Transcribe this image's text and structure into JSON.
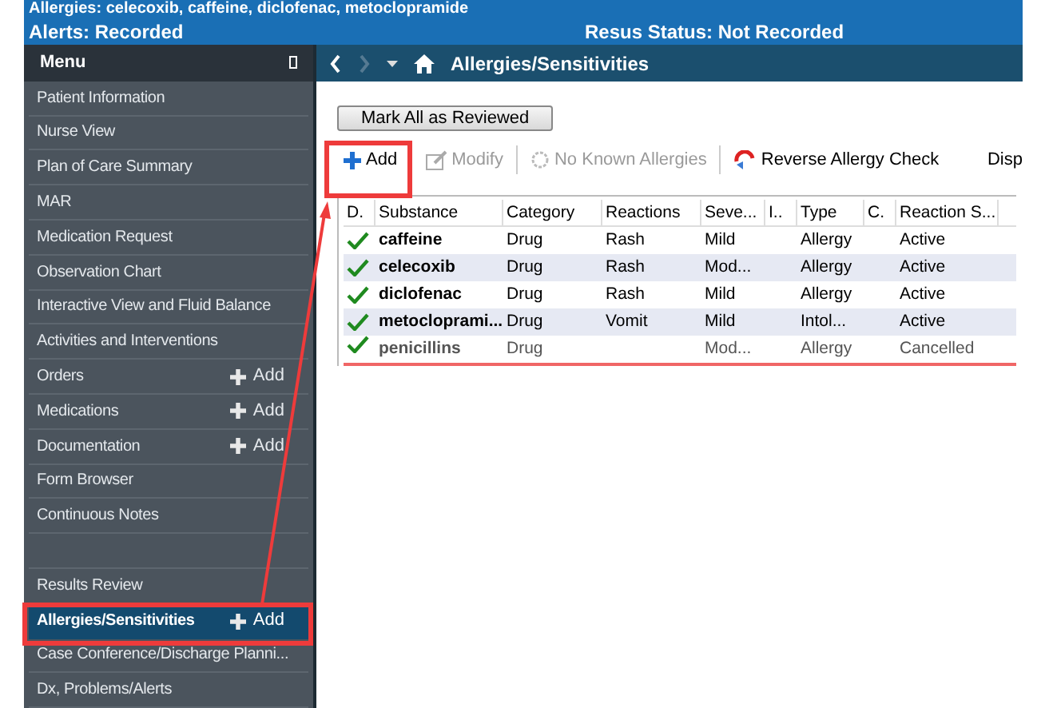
{
  "banner": {
    "allergies_line": "Allergies: celecoxib, caffeine, diclofenac, metoclopramide",
    "alerts": "Alerts: Recorded",
    "resus": "Resus Status: Not Recorded"
  },
  "menu": {
    "title": "Menu",
    "items": [
      {
        "label": "Patient Information",
        "selected": false
      },
      {
        "label": "Nurse View",
        "selected": false
      },
      {
        "label": "Plan of Care Summary",
        "selected": false
      },
      {
        "label": "MAR",
        "selected": false
      },
      {
        "label": "Medication Request",
        "selected": false
      },
      {
        "label": "Observation Chart",
        "selected": false
      },
      {
        "label": "Interactive View and Fluid Balance",
        "selected": false
      },
      {
        "label": "Activities and Interventions",
        "selected": false
      },
      {
        "label": "Orders",
        "selected": false,
        "add": "Add"
      },
      {
        "label": "Medications",
        "selected": false,
        "add": "Add"
      },
      {
        "label": "Documentation",
        "selected": false,
        "add": "Add"
      },
      {
        "label": "Form Browser",
        "selected": false
      },
      {
        "label": "Continuous Notes",
        "selected": false
      },
      {
        "label": "Results Review",
        "selected": false,
        "gap_before": true
      },
      {
        "label": "Allergies/Sensitivities",
        "selected": true,
        "add": "Add"
      },
      {
        "label": "Case Conference/Discharge Planni...",
        "selected": false
      },
      {
        "label": "Dx, Problems/Alerts",
        "selected": false
      }
    ]
  },
  "page": {
    "title": "Allergies/Sensitivities",
    "mark_all": "Mark All as Reviewed",
    "toolbar": [
      {
        "kind": "add",
        "label": "Add",
        "disabled": false
      },
      {
        "kind": "modify",
        "label": "Modify",
        "disabled": true
      },
      {
        "kind": "nka",
        "label": "No Known Allergies",
        "disabled": true
      },
      {
        "kind": "reverse",
        "label": "Reverse Allergy Check",
        "disabled": false
      }
    ],
    "toolbar_cut": "Disp",
    "table": {
      "columns": [
        "D.",
        "Substance",
        "Category",
        "Reactions",
        "Seve...",
        "I..",
        "Type",
        "C.",
        "Reaction S..."
      ],
      "rows": [
        {
          "reviewed": true,
          "cancelled": false,
          "cells": [
            "",
            "caffeine",
            "Drug",
            "Rash",
            "Mild",
            "",
            "Allergy",
            "",
            "Active"
          ]
        },
        {
          "reviewed": true,
          "cancelled": false,
          "cells": [
            "",
            "celecoxib",
            "Drug",
            "Rash",
            "Mod...",
            "",
            "Allergy",
            "",
            "Active"
          ]
        },
        {
          "reviewed": true,
          "cancelled": false,
          "cells": [
            "",
            "diclofenac",
            "Drug",
            "Rash",
            "Mild",
            "",
            "Allergy",
            "",
            "Active"
          ]
        },
        {
          "reviewed": true,
          "cancelled": false,
          "cells": [
            "",
            "metocloprami...",
            "Drug",
            "Vomit",
            "Mild",
            "",
            "Intol...",
            "",
            "Active"
          ]
        },
        {
          "reviewed": true,
          "cancelled": true,
          "cells": [
            "",
            "penicillins",
            "Drug",
            "",
            "Mod...",
            "",
            "Allergy",
            "",
            "Cancelled"
          ]
        }
      ]
    }
  }
}
